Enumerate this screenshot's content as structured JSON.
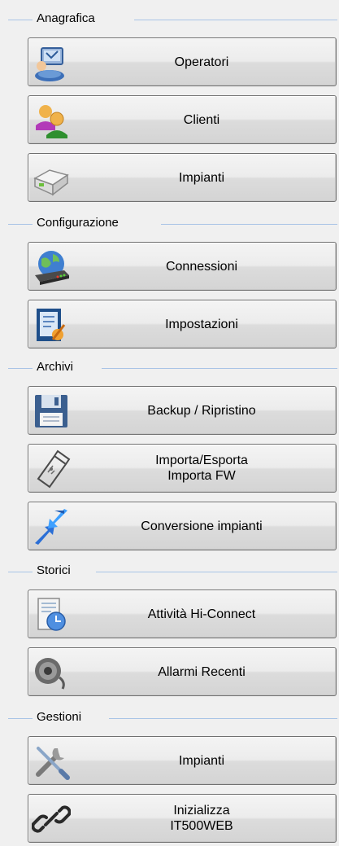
{
  "sections": {
    "anagrafica": {
      "title": "Anagrafica",
      "buttons": {
        "operatori": "Operatori",
        "clienti": "Clienti",
        "impianti": "Impianti"
      }
    },
    "configurazione": {
      "title": "Configurazione",
      "buttons": {
        "connessioni": "Connessioni",
        "impostazioni": "Impostazioni"
      }
    },
    "archivi": {
      "title": "Archivi",
      "buttons": {
        "backup": "Backup / Ripristino",
        "importa": "Importa/Esporta\nImporta FW",
        "conversione": "Conversione impianti"
      }
    },
    "storici": {
      "title": "Storici",
      "buttons": {
        "attivita": "Attività Hi-Connect",
        "allarmi": "Allarmi Recenti"
      }
    },
    "gestioni": {
      "title": "Gestioni",
      "buttons": {
        "impianti": "Impianti",
        "inizializza": "Inizializza\nIT500WEB"
      }
    }
  },
  "icons": {
    "operatori": "operator-icon",
    "clienti": "clients-icon",
    "impianti": "device-icon",
    "connessioni": "globe-network-icon",
    "impostazioni": "settings-doc-icon",
    "backup": "floppy-disk-icon",
    "importa": "usb-icon",
    "conversione": "convert-arrows-icon",
    "attivita": "activity-log-icon",
    "allarmi": "speaker-icon",
    "gestioni_impianti": "tools-icon",
    "inizializza": "link-icon"
  },
  "colors": {
    "background": "#f0f0f0",
    "divider": "#a9c4e6",
    "button_border": "#707070"
  }
}
